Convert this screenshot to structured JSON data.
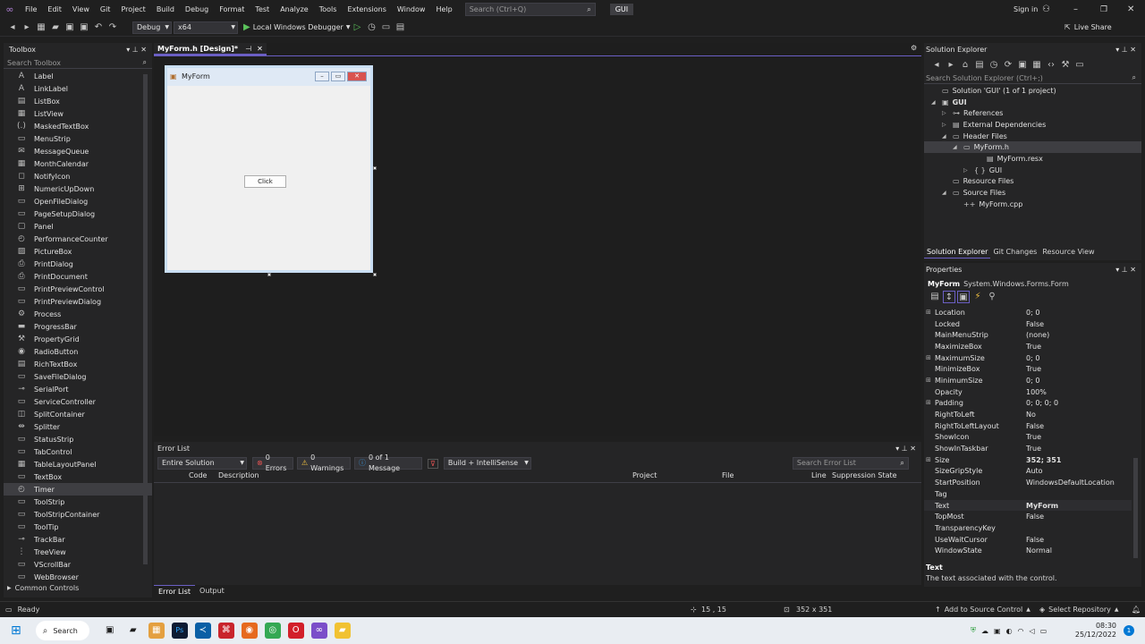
{
  "menubar": {
    "items": [
      "File",
      "Edit",
      "View",
      "Git",
      "Project",
      "Build",
      "Debug",
      "Format",
      "Test",
      "Analyze",
      "Tools",
      "Extensions",
      "Window",
      "Help"
    ],
    "search_placeholder": "Search (Ctrl+Q)",
    "solution_badge": "GUI",
    "signin": "Sign in"
  },
  "toolbar": {
    "config": "Debug",
    "platform": "x64",
    "run_label": "Local Windows Debugger",
    "live_share": "Live Share"
  },
  "toolbox": {
    "title": "Toolbox",
    "search_placeholder": "Search Toolbox",
    "items": [
      {
        "label": "Label",
        "icon": "A"
      },
      {
        "label": "LinkLabel",
        "icon": "A"
      },
      {
        "label": "ListBox",
        "icon": "▤"
      },
      {
        "label": "ListView",
        "icon": "▦"
      },
      {
        "label": "MaskedTextBox",
        "icon": "(.)"
      },
      {
        "label": "MenuStrip",
        "icon": "▭"
      },
      {
        "label": "MessageQueue",
        "icon": "✉"
      },
      {
        "label": "MonthCalendar",
        "icon": "▦"
      },
      {
        "label": "NotifyIcon",
        "icon": "◻"
      },
      {
        "label": "NumericUpDown",
        "icon": "⊞"
      },
      {
        "label": "OpenFileDialog",
        "icon": "▭"
      },
      {
        "label": "PageSetupDialog",
        "icon": "▭"
      },
      {
        "label": "Panel",
        "icon": "▢"
      },
      {
        "label": "PerformanceCounter",
        "icon": "◴"
      },
      {
        "label": "PictureBox",
        "icon": "▨"
      },
      {
        "label": "PrintDialog",
        "icon": "⎙"
      },
      {
        "label": "PrintDocument",
        "icon": "⎙"
      },
      {
        "label": "PrintPreviewControl",
        "icon": "▭"
      },
      {
        "label": "PrintPreviewDialog",
        "icon": "▭"
      },
      {
        "label": "Process",
        "icon": "⚙"
      },
      {
        "label": "ProgressBar",
        "icon": "▬"
      },
      {
        "label": "PropertyGrid",
        "icon": "⚒"
      },
      {
        "label": "RadioButton",
        "icon": "◉"
      },
      {
        "label": "RichTextBox",
        "icon": "▤"
      },
      {
        "label": "SaveFileDialog",
        "icon": "▭"
      },
      {
        "label": "SerialPort",
        "icon": "⊸"
      },
      {
        "label": "ServiceController",
        "icon": "▭"
      },
      {
        "label": "SplitContainer",
        "icon": "◫"
      },
      {
        "label": "Splitter",
        "icon": "⇹"
      },
      {
        "label": "StatusStrip",
        "icon": "▭"
      },
      {
        "label": "TabControl",
        "icon": "▭"
      },
      {
        "label": "TableLayoutPanel",
        "icon": "▦"
      },
      {
        "label": "TextBox",
        "icon": "▭"
      },
      {
        "label": "Timer",
        "icon": "◴"
      },
      {
        "label": "ToolStrip",
        "icon": "▭"
      },
      {
        "label": "ToolStripContainer",
        "icon": "▭"
      },
      {
        "label": "ToolTip",
        "icon": "▭"
      },
      {
        "label": "TrackBar",
        "icon": "⊸"
      },
      {
        "label": "TreeView",
        "icon": "⋮"
      },
      {
        "label": "VScrollBar",
        "icon": "▭"
      },
      {
        "label": "WebBrowser",
        "icon": "▭"
      }
    ],
    "category": "Common Controls"
  },
  "document": {
    "tab": "MyForm.h [Design]*",
    "form_title": "MyForm",
    "button_text": "Click"
  },
  "errorlist": {
    "title": "Error List",
    "scope": "Entire Solution",
    "errors": "0 Errors",
    "warnings": "0 Warnings",
    "messages": "0 of 1 Message",
    "build_filter": "Build + IntelliSense",
    "search_placeholder": "Search Error List",
    "columns": [
      "Code",
      "Description",
      "Project",
      "File",
      "Line",
      "Suppression State"
    ],
    "bottom_tabs": [
      "Error List",
      "Output"
    ]
  },
  "solution_explorer": {
    "title": "Solution Explorer",
    "search_placeholder": "Search Solution Explorer (Ctrl+;)",
    "tree": [
      {
        "label": "Solution 'GUI' (1 of 1 project)",
        "icon": "▭"
      },
      {
        "label": "GUI",
        "icon": "▣"
      },
      {
        "label": "References",
        "icon": "⊶"
      },
      {
        "label": "External Dependencies",
        "icon": "▤"
      },
      {
        "label": "Header Files",
        "icon": "▭"
      },
      {
        "label": "MyForm.h",
        "icon": "▭"
      },
      {
        "label": "MyForm.resx",
        "icon": "▤"
      },
      {
        "label": "GUI",
        "icon": "{ }"
      },
      {
        "label": "Resource Files",
        "icon": "▭"
      },
      {
        "label": "Source Files",
        "icon": "▭"
      },
      {
        "label": "MyForm.cpp",
        "icon": "++"
      }
    ],
    "tabs": [
      "Solution Explorer",
      "Git Changes",
      "Resource View"
    ]
  },
  "properties": {
    "title": "Properties",
    "object": "MyForm",
    "object_type": "System.Windows.Forms.Form",
    "rows": [
      {
        "k": "Location",
        "v": "0; 0"
      },
      {
        "k": "Locked",
        "v": "False"
      },
      {
        "k": "MainMenuStrip",
        "v": "(none)"
      },
      {
        "k": "MaximizeBox",
        "v": "True"
      },
      {
        "k": "MaximumSize",
        "v": "0; 0"
      },
      {
        "k": "MinimizeBox",
        "v": "True"
      },
      {
        "k": "MinimumSize",
        "v": "0; 0"
      },
      {
        "k": "Opacity",
        "v": "100%"
      },
      {
        "k": "Padding",
        "v": "0; 0; 0; 0"
      },
      {
        "k": "RightToLeft",
        "v": "No"
      },
      {
        "k": "RightToLeftLayout",
        "v": "False"
      },
      {
        "k": "ShowIcon",
        "v": "True"
      },
      {
        "k": "ShowInTaskbar",
        "v": "True"
      },
      {
        "k": "Size",
        "v": "352; 351"
      },
      {
        "k": "SizeGripStyle",
        "v": "Auto"
      },
      {
        "k": "StartPosition",
        "v": "WindowsDefaultLocation"
      },
      {
        "k": "Tag",
        "v": ""
      },
      {
        "k": "Text",
        "v": "MyForm"
      },
      {
        "k": "TopMost",
        "v": "False"
      },
      {
        "k": "TransparencyKey",
        "v": ""
      },
      {
        "k": "UseWaitCursor",
        "v": "False"
      },
      {
        "k": "WindowState",
        "v": "Normal"
      }
    ],
    "desc_title": "Text",
    "desc_text": "The text associated with the control."
  },
  "status": {
    "ready": "Ready",
    "position": "15 , 15",
    "size": "352 x 351",
    "source_control": "Add to Source Control",
    "repo": "Select Repository"
  },
  "taskbar": {
    "search": "Search",
    "time": "08:30",
    "date": "25/12/2022"
  }
}
